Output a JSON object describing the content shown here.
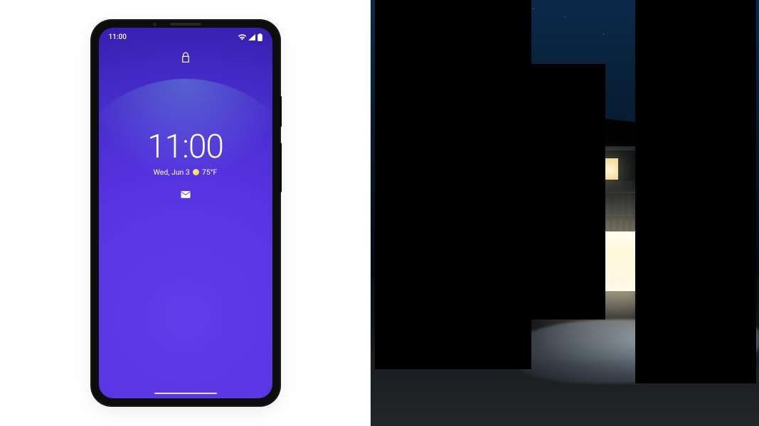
{
  "phone": {
    "status_bar": {
      "time": "11:00"
    },
    "lockscreen": {
      "clock": "11:00",
      "date": "Wed, Jun 3",
      "temperature": "75°F"
    }
  }
}
